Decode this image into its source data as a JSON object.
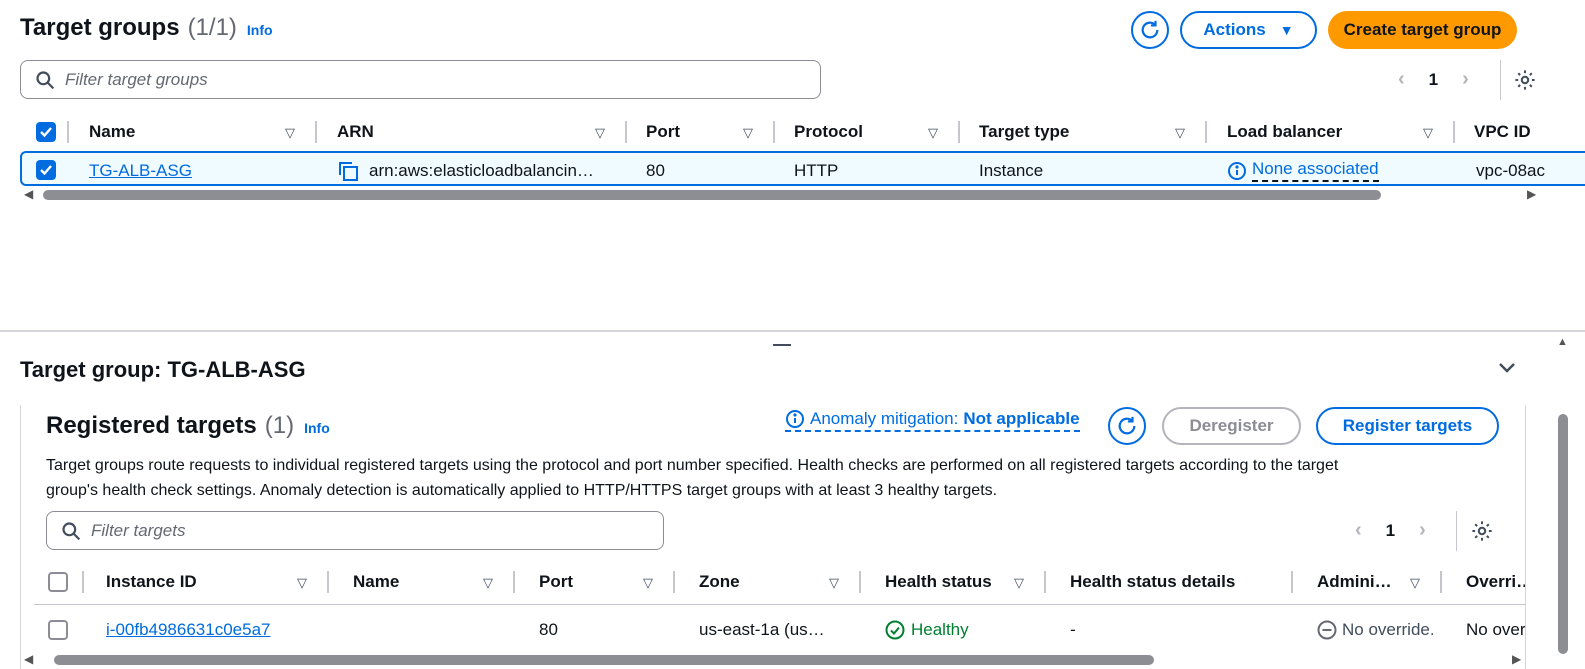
{
  "top": {
    "title": "Target groups",
    "count": "(1/1)",
    "info": "Info",
    "actions_label": "Actions",
    "create_label": "Create target group",
    "search_placeholder": "Filter target groups",
    "page": "1",
    "columns": [
      "Name",
      "ARN",
      "Port",
      "Protocol",
      "Target type",
      "Load balancer",
      "VPC ID"
    ],
    "row": {
      "name": "TG-ALB-ASG",
      "arn": "arn:aws:elasticloadbalancin…",
      "port": "80",
      "protocol": "HTTP",
      "target_type": "Instance",
      "load_balancer": "None associated",
      "vpc": "vpc-08ac"
    }
  },
  "detail": {
    "title": "Target group: TG-ALB-ASG",
    "registered_title": "Registered targets",
    "registered_count": "(1)",
    "info": "Info",
    "anomaly_label": "Anomaly mitigation:",
    "anomaly_value": "Not applicable",
    "deregister_label": "Deregister",
    "register_label": "Register targets",
    "description_line1": "Target groups route requests to individual registered targets using the protocol and port number specified. Health checks are performed on all registered targets according to the target",
    "description_line2": "group's health check settings. Anomaly detection is automatically applied to HTTP/HTTPS target groups with at least 3 healthy targets.",
    "search_placeholder": "Filter targets",
    "page": "1",
    "columns": [
      "Instance ID",
      "Name",
      "Port",
      "Zone",
      "Health status",
      "Health status details",
      "Admini…",
      "Overri…"
    ],
    "row": {
      "instance_id": "i-00fb4986631c0e5a7",
      "name": "",
      "port": "80",
      "zone": "us-east-1a (us…",
      "health": "Healthy",
      "health_details": "-",
      "admin": "No override.",
      "override": "No over"
    }
  },
  "colors": {
    "accent": "#006ce0",
    "primary_button": "#ff9900",
    "healthy": "#00802f",
    "selected_row_bg": "#f0fbff"
  }
}
